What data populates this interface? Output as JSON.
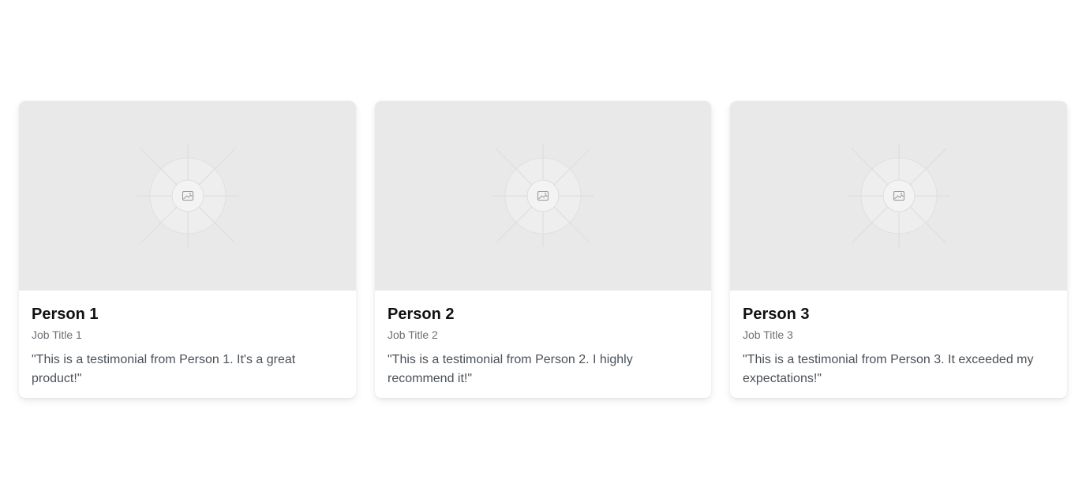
{
  "testimonials": [
    {
      "name": "Person 1",
      "job_title": "Job Title 1",
      "quote": "\"This is a testimonial from Person 1. It's a great product!\"",
      "image_icon": "image-placeholder-icon"
    },
    {
      "name": "Person 2",
      "job_title": "Job Title 2",
      "quote": "\"This is a testimonial from Person 2. I highly recommend it!\"",
      "image_icon": "image-placeholder-icon"
    },
    {
      "name": "Person 3",
      "job_title": "Job Title 3",
      "quote": "\"This is a testimonial from Person 3. It exceeded my expectations!\"",
      "image_icon": "image-placeholder-icon"
    }
  ],
  "colors": {
    "placeholder_bg": "#e9e9e9",
    "name_text": "#111111",
    "job_title_text": "#6b7075",
    "quote_text": "#4b5158"
  }
}
